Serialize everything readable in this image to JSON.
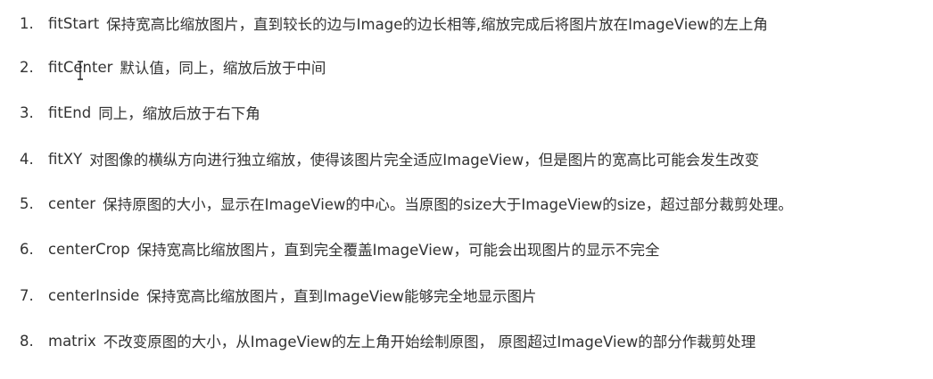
{
  "items": [
    {
      "number": "1.",
      "term": "fitStart",
      "desc": "保持宽高比缩放图片，直到较长的边与Image的边长相等,缩放完成后将图片放在ImageView的左上角"
    },
    {
      "number": "2.",
      "term": "fitCenter",
      "desc": "默认值，同上，缩放后放于中间"
    },
    {
      "number": "3.",
      "term": "fitEnd",
      "desc": "同上，缩放后放于右下角"
    },
    {
      "number": "4.",
      "term": "fitXY",
      "desc": "对图像的横纵方向进行独立缩放，使得该图片完全适应ImageView，但是图片的宽高比可能会发生改变"
    },
    {
      "number": "5.",
      "term": "center",
      "desc": "保持原图的大小，显示在ImageView的中心。当原图的size大于ImageView的size，超过部分裁剪处理。"
    },
    {
      "number": "6.",
      "term": "centerCrop",
      "desc": "保持宽高比缩放图片，直到完全覆盖ImageView，可能会出现图片的显示不完全"
    },
    {
      "number": "7.",
      "term": "centerInside",
      "desc": "保持宽高比缩放图片，直到ImageView能够完全地显示图片"
    },
    {
      "number": "8.",
      "term": "matrix",
      "desc": "不改变原图的大小，从ImageView的左上角开始绘制原图， 原图超过ImageView的部分作裁剪处理"
    }
  ],
  "cursor_icon": "text-cursor-icon"
}
